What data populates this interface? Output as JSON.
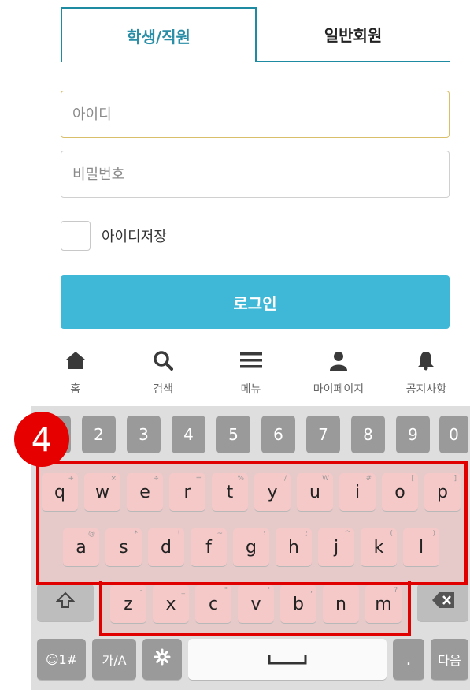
{
  "tabs": [
    {
      "label": "학생/직원",
      "active": true
    },
    {
      "label": "일반회원",
      "active": false
    }
  ],
  "form": {
    "id_placeholder": "아이디",
    "pw_placeholder": "비밀번호",
    "remember_label": "아이디저장",
    "remember_checked": false,
    "login_label": "로그인"
  },
  "bottom_nav": [
    {
      "label": "홈",
      "icon": "home-icon"
    },
    {
      "label": "검색",
      "icon": "search-icon"
    },
    {
      "label": "메뉴",
      "icon": "menu-icon"
    },
    {
      "label": "마이페이지",
      "icon": "user-icon"
    },
    {
      "label": "공지사항",
      "icon": "bell-icon"
    }
  ],
  "keyboard": {
    "numbers": [
      "2",
      "3",
      "4",
      "5",
      "6",
      "7",
      "8",
      "9",
      "0"
    ],
    "row1": [
      "q",
      "w",
      "e",
      "r",
      "t",
      "y",
      "u",
      "i",
      "o",
      "p"
    ],
    "row1_hints": [
      "+",
      "×",
      "÷",
      "=",
      "%",
      "/",
      "W",
      "#",
      "[",
      "]"
    ],
    "row2": [
      "a",
      "s",
      "d",
      "f",
      "g",
      "h",
      "j",
      "k",
      "l"
    ],
    "row2_hints": [
      "@",
      "*",
      "!",
      "~",
      ":",
      ";",
      "^",
      "(",
      ")"
    ],
    "row3": [
      "z",
      "x",
      "c",
      "v",
      "b",
      "n",
      "m"
    ],
    "row3_hints": [
      "-",
      "_",
      "\"",
      "'",
      ",",
      "",
      "?"
    ],
    "symbols_label": "☺1#",
    "lang_label": "가/A",
    "period_label": ".",
    "next_label": "다음"
  },
  "annotation": {
    "badge": "4",
    "color": "#e00000"
  },
  "colors": {
    "accent": "#3fb8d8",
    "tab_border": "#1f8ba2"
  }
}
